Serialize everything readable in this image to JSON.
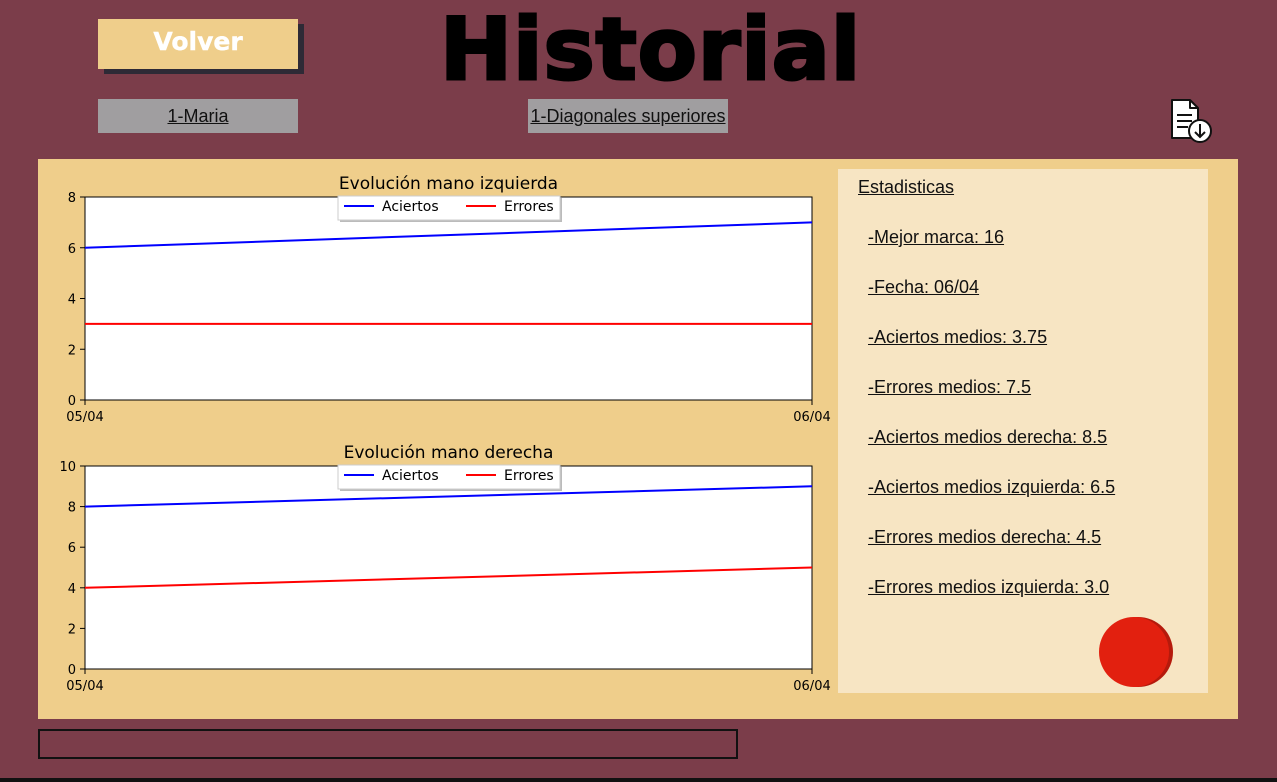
{
  "header": {
    "back_label": "Volver",
    "title": "Historial",
    "user_select": "1-Maria",
    "exercise_select": "1-Diagonales superiores"
  },
  "icons": {
    "export": "file-download-icon",
    "record": "record-icon"
  },
  "colors": {
    "background": "#7b3d4a",
    "panel": "#efce8b",
    "stats_panel": "#f7e5c3",
    "accent_button": "#efce8b",
    "record": "#e2200f",
    "series_aciertos": "#0000ff",
    "series_errores": "#ff0000"
  },
  "stats": {
    "heading": "Estadisticas",
    "items": [
      "-Mejor marca: 16",
      "-Fecha: 06/04",
      "-Aciertos medios: 3.75",
      "-Errores medios: 7.5",
      "-Aciertos medios derecha: 8.5",
      "-Aciertos medios izquierda: 6.5",
      "-Errores medios derecha: 4.5",
      "-Errores medios izquierda: 3.0"
    ]
  },
  "chart_data": [
    {
      "type": "line",
      "title": "Evolución mano izquierda",
      "categories": [
        "05/04",
        "06/04"
      ],
      "ylim": [
        0,
        8
      ],
      "yticks": [
        0,
        2,
        4,
        6,
        8
      ],
      "grid": false,
      "legend": "top-center",
      "series": [
        {
          "name": "Aciertos",
          "color": "#0000ff",
          "values": [
            6,
            7
          ]
        },
        {
          "name": "Errores",
          "color": "#ff0000",
          "values": [
            3,
            3
          ]
        }
      ]
    },
    {
      "type": "line",
      "title": "Evolución mano derecha",
      "categories": [
        "05/04",
        "06/04"
      ],
      "ylim": [
        0,
        10
      ],
      "yticks": [
        0,
        2,
        4,
        6,
        8,
        10
      ],
      "grid": false,
      "legend": "top-center",
      "series": [
        {
          "name": "Aciertos",
          "color": "#0000ff",
          "values": [
            8,
            9
          ]
        },
        {
          "name": "Errores",
          "color": "#ff0000",
          "values": [
            4,
            5
          ]
        }
      ]
    }
  ]
}
